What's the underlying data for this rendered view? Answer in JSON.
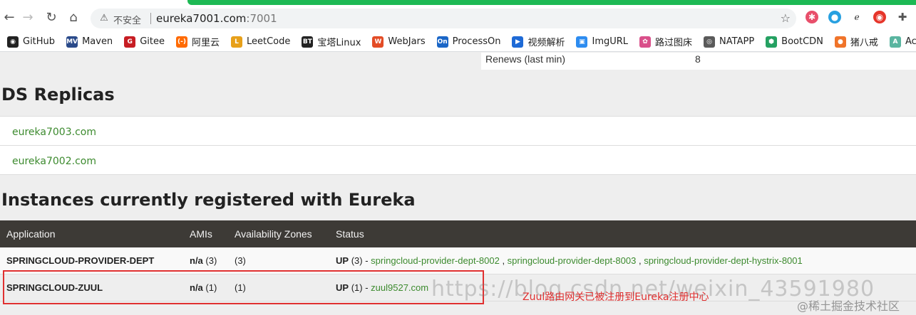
{
  "browser": {
    "nav": {
      "back": "←",
      "forward": "→",
      "reload": "↻",
      "home": "⌂"
    },
    "address": {
      "warning": "⚠",
      "insecure_label": "不安全",
      "host": "eureka7001.com",
      "port": ":7001"
    },
    "star": "☆",
    "colors": {
      "loading_bar": "#1db954"
    },
    "bookmarks": [
      {
        "label": "GitHub",
        "icon": "github-icon",
        "color": "#222222",
        "glyph": "◉"
      },
      {
        "label": "Maven",
        "icon": "maven-icon",
        "color": "#2a4a8a",
        "glyph": "MV"
      },
      {
        "label": "Gitee",
        "icon": "gitee-icon",
        "color": "#c71d23",
        "glyph": "G"
      },
      {
        "label": "阿里云",
        "icon": "aliyun-icon",
        "color": "#ff6a00",
        "glyph": "(-)"
      },
      {
        "label": "LeetCode",
        "icon": "leetcode-icon",
        "color": "#e7a01a",
        "glyph": "L"
      },
      {
        "label": "宝塔Linux",
        "icon": "bt-icon",
        "color": "#222222",
        "glyph": "BT"
      },
      {
        "label": "WebJars",
        "icon": "webjars-icon",
        "color": "#e34c26",
        "glyph": "W"
      },
      {
        "label": "ProcessOn",
        "icon": "processon-icon",
        "color": "#1a66c7",
        "glyph": "On"
      },
      {
        "label": "视频解析",
        "icon": "video-icon",
        "color": "#1e6ad6",
        "glyph": "▶"
      },
      {
        "label": "ImgURL",
        "icon": "image-icon",
        "color": "#2d8cf0",
        "glyph": "▣"
      },
      {
        "label": "路过图床",
        "icon": "flower-icon",
        "color": "#d94f8a",
        "glyph": "✿"
      },
      {
        "label": "NATAPP",
        "icon": "natapp-icon",
        "color": "#5a5a5a",
        "glyph": "◎"
      },
      {
        "label": "BootCDN",
        "icon": "bootcdn-icon",
        "color": "#25a162",
        "glyph": "⬢"
      },
      {
        "label": "猪八戒",
        "icon": "zbj-icon",
        "color": "#f0742a",
        "glyph": "●"
      },
      {
        "label": "AcWing",
        "icon": "acwing-icon",
        "color": "#5ab5a0",
        "glyph": "A"
      }
    ]
  },
  "page": {
    "renews": {
      "label": "Renews (last min)",
      "value": "8"
    },
    "ds_title": "DS Replicas",
    "replicas": [
      "eureka7003.com",
      "eureka7002.com"
    ],
    "instances_title": "Instances currently registered with Eureka",
    "table": {
      "headers": [
        "Application",
        "AMIs",
        "Availability Zones",
        "Status"
      ],
      "rows": [
        {
          "application": "SPRINGCLOUD-PROVIDER-DEPT",
          "amis_prefix": "n/a",
          "amis_count": "(3)",
          "zones": "(3)",
          "status_prefix": "UP",
          "status_count": "(3) -",
          "links": [
            "springcloud-provider-dept-8002",
            "springcloud-provider-dept-8003",
            "springcloud-provider-dept-hystrix-8001"
          ]
        },
        {
          "application": "SPRINGCLOUD-ZUUL",
          "amis_prefix": "n/a",
          "amis_count": "(1)",
          "zones": "(1)",
          "status_prefix": "UP",
          "status_count": "(1) -",
          "links": [
            "zuul9527.com"
          ]
        }
      ]
    },
    "annotation": {
      "note": "Zuul路由网关已被注册到Eureka注册中心",
      "color": "#e03030"
    },
    "watermark": "https://blog.csdn.net/weixin_43591980",
    "watermark2": "@稀土掘金技术社区"
  }
}
